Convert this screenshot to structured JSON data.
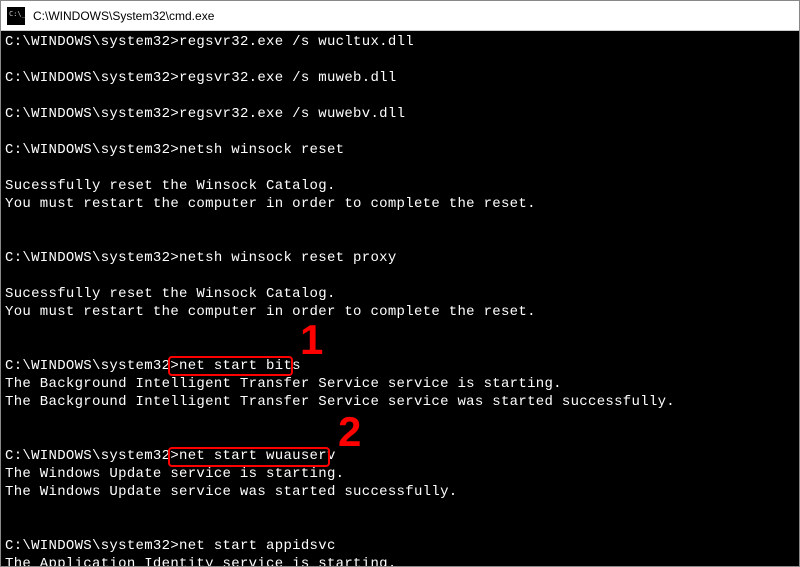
{
  "titlebar": {
    "path": "C:\\WINDOWS\\System32\\cmd.exe"
  },
  "prompt": "C:\\WINDOWS\\system32>",
  "lines": [
    {
      "type": "cmd",
      "command": "regsvr32.exe /s wucltux.dll"
    },
    {
      "type": "blank"
    },
    {
      "type": "cmd",
      "command": "regsvr32.exe /s muweb.dll"
    },
    {
      "type": "blank"
    },
    {
      "type": "cmd",
      "command": "regsvr32.exe /s wuwebv.dll"
    },
    {
      "type": "blank"
    },
    {
      "type": "cmd",
      "command": "netsh winsock reset"
    },
    {
      "type": "blank"
    },
    {
      "type": "out",
      "text": "Sucessfully reset the Winsock Catalog."
    },
    {
      "type": "out",
      "text": "You must restart the computer in order to complete the reset."
    },
    {
      "type": "blank"
    },
    {
      "type": "blank"
    },
    {
      "type": "cmd",
      "command": "netsh winsock reset proxy"
    },
    {
      "type": "blank"
    },
    {
      "type": "out",
      "text": "Sucessfully reset the Winsock Catalog."
    },
    {
      "type": "out",
      "text": "You must restart the computer in order to complete the reset."
    },
    {
      "type": "blank"
    },
    {
      "type": "blank"
    },
    {
      "type": "cmd",
      "command": "net start bits"
    },
    {
      "type": "out",
      "text": "The Background Intelligent Transfer Service service is starting."
    },
    {
      "type": "out",
      "text": "The Background Intelligent Transfer Service service was started successfully."
    },
    {
      "type": "blank"
    },
    {
      "type": "blank"
    },
    {
      "type": "cmd",
      "command": "net start wuauserv"
    },
    {
      "type": "out",
      "text": "The Windows Update service is starting."
    },
    {
      "type": "out",
      "text": "The Windows Update service was started successfully."
    },
    {
      "type": "blank"
    },
    {
      "type": "blank"
    },
    {
      "type": "cmd",
      "command": "net start appidsvc"
    },
    {
      "type": "out",
      "text": "The Application Identity service is starting."
    }
  ],
  "annotations": {
    "box1": {
      "label": "1"
    },
    "box2": {
      "label": "2"
    }
  }
}
